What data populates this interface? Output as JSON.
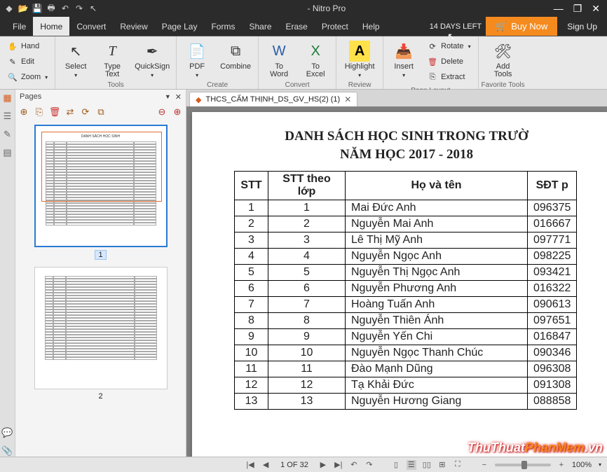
{
  "window": {
    "title": "- Nitro Pro"
  },
  "qat_icons": [
    "app",
    "open",
    "save",
    "print",
    "undo",
    "redo",
    "pointer"
  ],
  "menu": {
    "items": [
      "File",
      "Home",
      "Convert",
      "Review",
      "Page Lay",
      "Forms",
      "Share",
      "Erase",
      "Protect",
      "Help"
    ],
    "active_index": 1,
    "trial": "14 DAYS LEFT",
    "buy": "Buy Now",
    "signup": "Sign Up"
  },
  "ribbon": {
    "left": {
      "hand": "Hand",
      "edit": "Edit",
      "zoom": "Zoom"
    },
    "tools": {
      "label": "Tools",
      "select": "Select",
      "typetext": "Type\nText",
      "quicksign": "QuickSign"
    },
    "create": {
      "label": "Create",
      "pdf": "PDF",
      "combine": "Combine"
    },
    "convert": {
      "label": "Convert",
      "toword": "To\nWord",
      "toexcel": "To\nExcel"
    },
    "review": {
      "label": "Review",
      "highlight": "Highlight"
    },
    "pagelayout": {
      "label": "Page Layout",
      "insert": "Insert",
      "rotate": "Rotate",
      "delete": "Delete",
      "extract": "Extract"
    },
    "fav": {
      "label": "Favorite Tools",
      "addtools": "Add\nTools"
    }
  },
  "pages_panel": {
    "title": "Pages",
    "page1": "1",
    "page2": "2"
  },
  "doc_tab": {
    "name": "THCS_CẨM THỊNH_DS_GV_HS(2) (1)"
  },
  "document": {
    "title1": "DANH SÁCH HỌC SINH TRONG TRƯỜ",
    "title2": "NĂM HỌC 2017 - 2018",
    "headers": {
      "stt": "STT",
      "stt_lop": "STT theo lớp",
      "name": "Họ và tên",
      "phone": "SĐT p"
    },
    "rows": [
      {
        "stt": "1",
        "sttl": "1",
        "name": "Mai Đức Anh",
        "ph": "096375"
      },
      {
        "stt": "2",
        "sttl": "2",
        "name": "Nguyễn Mai Anh",
        "ph": "016667"
      },
      {
        "stt": "3",
        "sttl": "3",
        "name": "Lê Thị Mỹ Anh",
        "ph": "097771"
      },
      {
        "stt": "4",
        "sttl": "4",
        "name": "Nguyễn Ngọc Anh",
        "ph": "098225"
      },
      {
        "stt": "5",
        "sttl": "5",
        "name": "Nguyễn Thị Ngọc Anh",
        "ph": "093421"
      },
      {
        "stt": "6",
        "sttl": "6",
        "name": "Nguyễn Phương Anh",
        "ph": "016322"
      },
      {
        "stt": "7",
        "sttl": "7",
        "name": "Hoàng Tuấn Anh",
        "ph": "090613"
      },
      {
        "stt": "8",
        "sttl": "8",
        "name": "Nguyễn Thiên Ánh",
        "ph": "097651"
      },
      {
        "stt": "9",
        "sttl": "9",
        "name": "Nguyễn Yến Chi",
        "ph": "016847"
      },
      {
        "stt": "10",
        "sttl": "10",
        "name": "Nguyễn Ngọc Thanh Chúc",
        "ph": "090346"
      },
      {
        "stt": "11",
        "sttl": "11",
        "name": "Đào Mạnh Dũng",
        "ph": "096308"
      },
      {
        "stt": "12",
        "sttl": "12",
        "name": "Tạ Khải Đức",
        "ph": "091308"
      },
      {
        "stt": "13",
        "sttl": "13",
        "name": "Nguyễn Hương Giang",
        "ph": "088858"
      }
    ]
  },
  "status": {
    "page": "1 OF 32",
    "zoom": "100%"
  },
  "watermark": {
    "t1": "ThuThuat",
    "t2": "PhanMem",
    "t3": ".vn"
  }
}
